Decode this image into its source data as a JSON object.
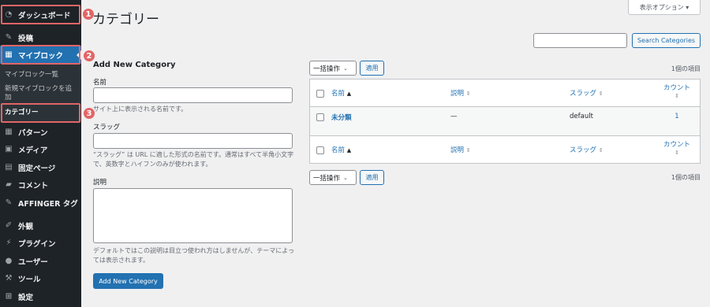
{
  "sidebar": {
    "items": [
      {
        "label": "ダッシュボード",
        "icon": "dashboard-icon"
      },
      {
        "label": "投稿",
        "icon": "pin-icon"
      },
      {
        "label": "マイブロック",
        "icon": "blocks-icon"
      },
      {
        "label": "パターン",
        "icon": "grid-icon"
      },
      {
        "label": "メディア",
        "icon": "media-icon"
      },
      {
        "label": "固定ページ",
        "icon": "page-icon"
      },
      {
        "label": "コメント",
        "icon": "comment-icon"
      },
      {
        "label": "AFFINGER タグ",
        "icon": "pin-icon"
      },
      {
        "label": "外観",
        "icon": "brush-icon"
      },
      {
        "label": "プラグイン",
        "icon": "plugin-icon"
      },
      {
        "label": "ユーザー",
        "icon": "user-icon"
      },
      {
        "label": "ツール",
        "icon": "wrench-icon"
      },
      {
        "label": "設定",
        "icon": "settings-icon"
      }
    ],
    "submenu": [
      "マイブロック一覧",
      "新規マイブロックを追加",
      "カテゴリー"
    ]
  },
  "annotations": [
    "1",
    "2",
    "3"
  ],
  "page": {
    "title": "カテゴリー",
    "screen_options": "表示オプション ▾",
    "search_button": "Search Categories",
    "search_value": ""
  },
  "form": {
    "title": "Add New Category",
    "name_label": "名前",
    "name_desc": "サイト上に表示される名前です。",
    "slug_label": "スラッグ",
    "slug_desc": "“スラッグ” は URL に適した形式の名前です。通常はすべて半角小文字で、英数字とハイフンのみが使われます。",
    "desc_label": "説明",
    "desc_desc": "デフォルトではこの説明は目立つ使われ方はしませんが、テーマによっては表示されます。",
    "submit": "Add New Category"
  },
  "table": {
    "bulk_action": "一括操作",
    "apply": "適用",
    "item_count": "1個の項目",
    "columns": {
      "name": "名前",
      "description": "説明",
      "slug": "スラッグ",
      "count": "カウント"
    },
    "rows": [
      {
        "name": "未分類",
        "description": "—",
        "slug": "default",
        "count": "1"
      }
    ]
  },
  "colors": {
    "sidebar_bg": "#1d2327",
    "active": "#2271b1",
    "highlight": "#e26566",
    "link": "#2271b1"
  }
}
